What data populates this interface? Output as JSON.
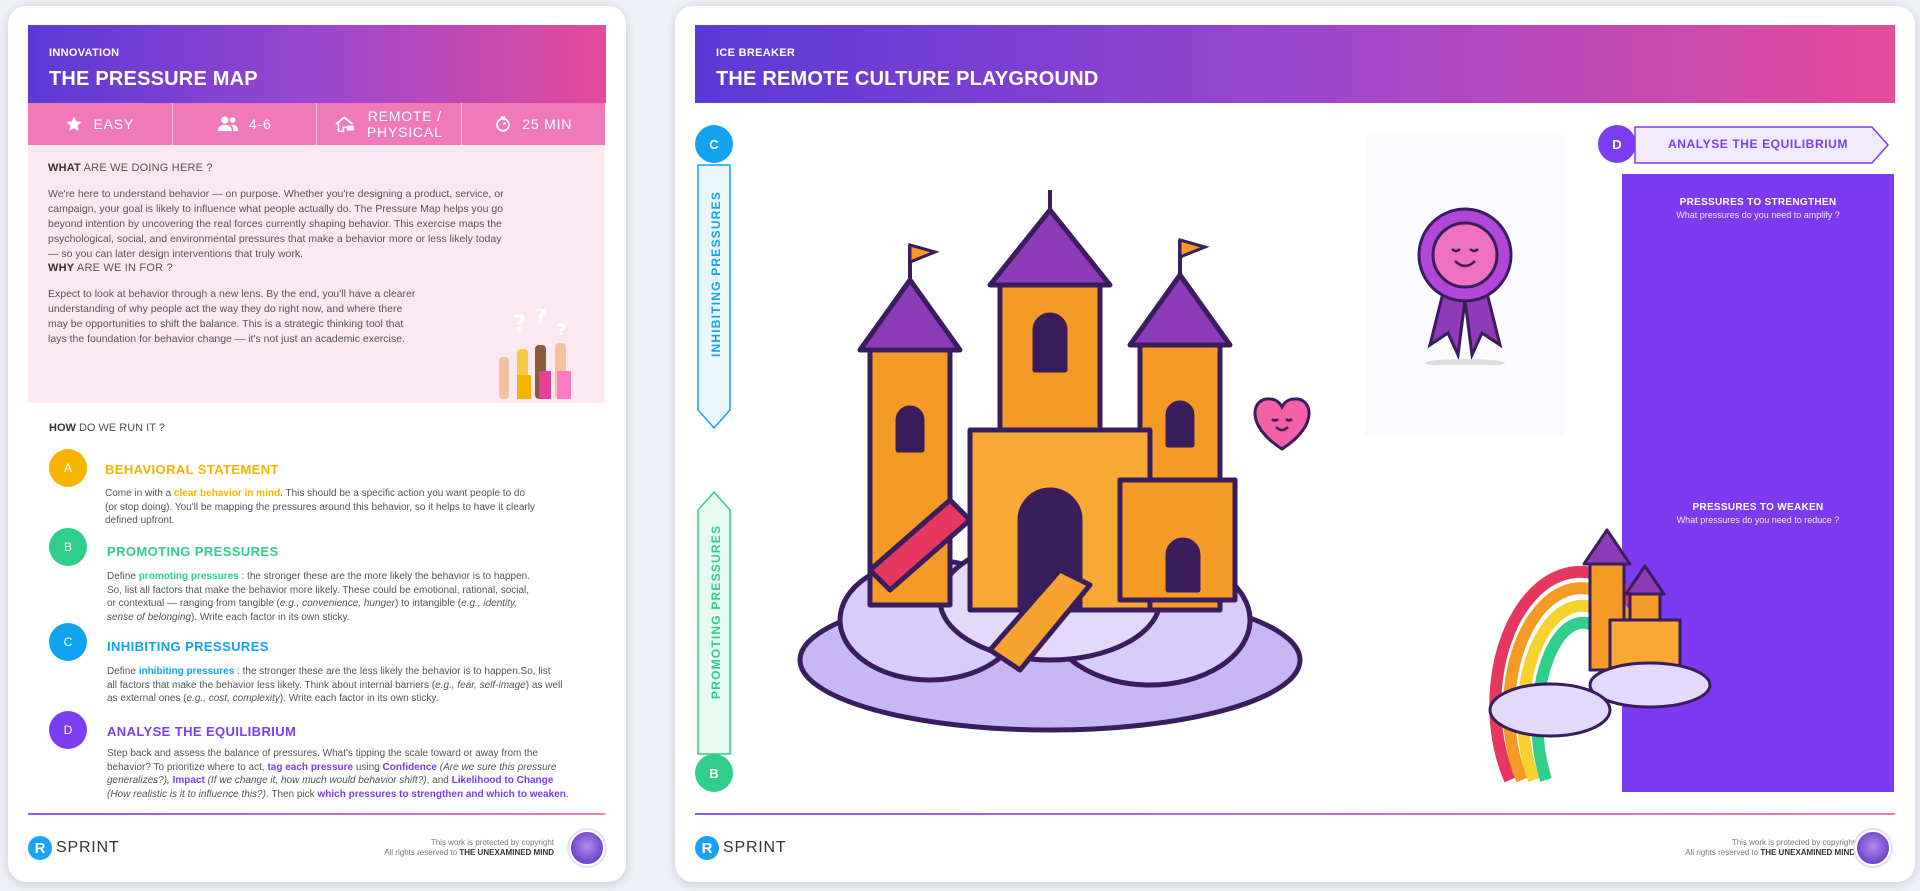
{
  "left": {
    "kicker": "INNOVATION",
    "title": "THE PRESSURE MAP",
    "meta": [
      {
        "icon": "star-icon",
        "label": "EASY"
      },
      {
        "icon": "people-icon",
        "label": "4-6"
      },
      {
        "icon": "home-icon",
        "label": "REMOTE / PHYSICAL"
      },
      {
        "icon": "timer-icon",
        "label": "25 MIN"
      }
    ],
    "what_bold": "WHAT",
    "what_rest": " ARE WE DOING HERE ?",
    "what_lines": [
      "We're here to understand behavior — on purpose. Whether you're designing a product, service, or",
      "campaign, your goal is likely to influence what people actually do. The Pressure Map helps you go",
      "beyond intention by uncovering the real forces currently shaping behavior. This exercise maps the",
      "psychological, social, and environmental pressures that make a behavior more or less likely today",
      "— so you can later design interventions that truly work."
    ],
    "why_bold": "WHY",
    "why_rest": " ARE WE IN FOR ?",
    "why_lines": [
      "Expect to look at behavior through a new lens. By the end, you'll have a clearer",
      "understanding of why people act the way they do right now, and where there",
      "may be opportunities to shift the balance. This is a strategic thinking tool that",
      "lays the foundation for behavior change — it's not just an academic exercise."
    ],
    "how_bold": "HOW",
    "how_rest": " DO WE RUN IT ?",
    "steps": {
      "a": {
        "letter": "A",
        "title": "BEHAVIORAL STATEMENT",
        "l1a": "Come in with a ",
        "l1b": "clear behavior in mind",
        "l1c": ". This should be a specific action you want people to do",
        "l2": "(or stop doing). You'll be mapping the pressures around this behavior, so it helps to have it clearly",
        "l3": "defined upfront."
      },
      "b": {
        "letter": "B",
        "title": "PROMOTING PRESSURES",
        "l1a": "Define ",
        "l1b": "promoting pressures",
        "l1c": " : the stronger these are the more likely the behavior is to happen.",
        "l2": "So, list all factors that make the behavior more likely. These could be emotional, rational, social,",
        "l3a": "or contextual — ranging from tangible (",
        "l3b": "e.g., convenience, hunger",
        "l3c": ") to intangible (",
        "l3d": "e.g., identity,",
        "l4a": "sense of belonging",
        "l4b": "). Write each factor in its own sticky."
      },
      "c": {
        "letter": "C",
        "title": "INHIBITING PRESSURES",
        "l1a": "Define ",
        "l1b": "inhibiting pressures",
        "l1c": " : the stronger these are the less likely the behavior is to happen.So, list",
        "l2a": "all factors that make the behavior less likely. Think about internal barriers (",
        "l2b": "e.g., fear, self-image",
        "l2c": ") as well",
        "l3a": "as external ones (",
        "l3b": "e.g., cost, complexity",
        "l3c": "). Write each factor in its own sticky."
      },
      "d": {
        "letter": "D",
        "title": "ANALYSE THE EQUILIBRIUM",
        "l1": "Step back and assess the balance of pressures. What's tipping the scale toward or away from the",
        "l2a": "behavior? To prioritize where to act, ",
        "l2b": "tag each pressure",
        "l2c": " using ",
        "l2d": "Confidence",
        "l2e": " (Are we sure this pressure",
        "l3a": "generalizes?), ",
        "l3b": "Impact",
        "l3c": " (If we change it, how much would behavior shift?)",
        "l3d": ", and ",
        "l3e": "Likelihood to Change",
        "l4a": "(How realistic is it to influence this?)",
        "l4b": ". Then pick ",
        "l4c": "which pressures to strengthen and which to weaken",
        "l4d": "."
      }
    }
  },
  "right": {
    "kicker": "ICE BREAKER",
    "title": "THE REMOTE CULTURE PLAYGROUND",
    "c_letter": "C",
    "b_letter": "B",
    "d_letter": "D",
    "inhibiting_label": "INHIBITING PRESSURES",
    "promoting_label": "PROMOTING PRESSURES",
    "d_title": "ANALYSE THE EQUILIBRIUM",
    "strengthen_title": "PRESSURES TO STRENGTHEN",
    "strengthen_sub": "What pressures do you need to amplify ?",
    "weaken_title": "PRESSURES TO WEAKEN",
    "weaken_sub": "What pressures do you need to reduce ?"
  },
  "footer": {
    "logo_r": "R",
    "logo_text": "SPRINT",
    "copy_line1": "This work is protected by copyright",
    "copy_line2a": "All rights reserved to ",
    "copy_line2b": "THE UNEXAMINED MIND"
  },
  "colors": {
    "a": "#f5b400",
    "b": "#2fcf8b",
    "c": "#12a3f0",
    "d": "#7b3df0",
    "pink": "#f07ab8",
    "panel": "#7c3bf0"
  }
}
